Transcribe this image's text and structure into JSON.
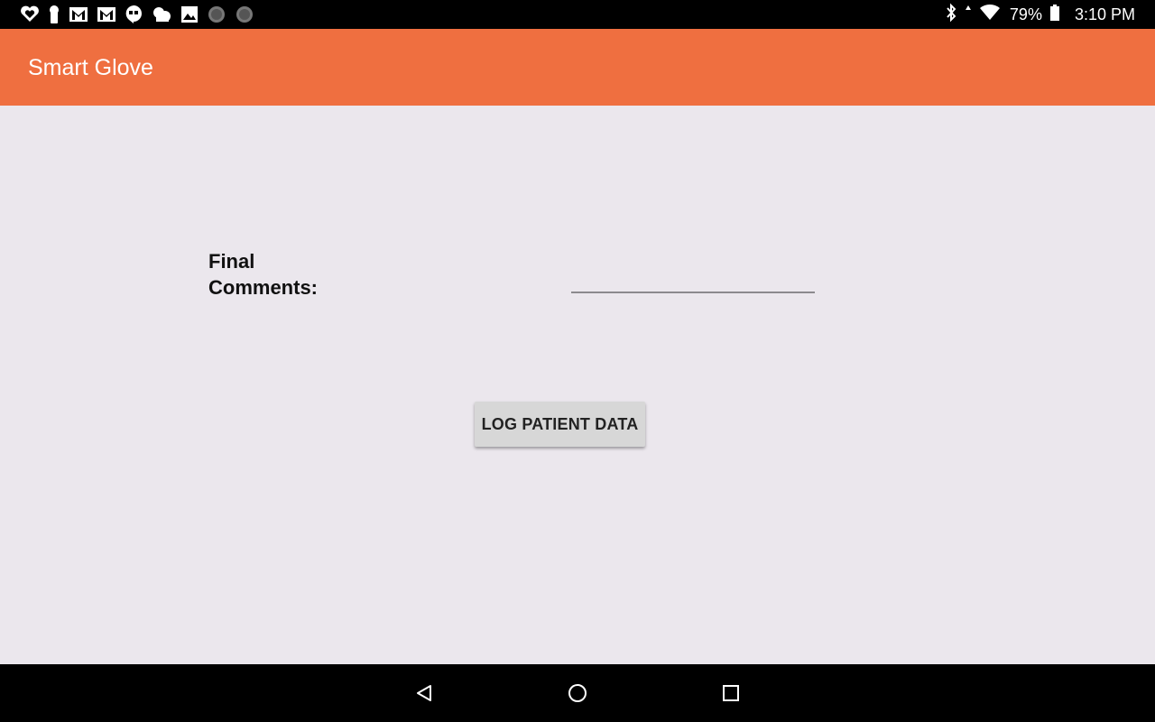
{
  "status_bar": {
    "notification_icons": [
      "heart-icon",
      "keyhole-icon",
      "gmail-icon",
      "gmail-icon",
      "hangouts-icon",
      "weather-icon",
      "photo-icon",
      "circle-icon",
      "circle-icon"
    ],
    "system_icons": [
      "bluetooth-icon",
      "wifi-icon",
      "battery-icon"
    ],
    "battery_percent": "79%",
    "time": "3:10 PM"
  },
  "app_bar": {
    "title": "Smart Glove",
    "color": "#ef6f40"
  },
  "form": {
    "final_comments_label": "Final Comments:",
    "final_comments_value": ""
  },
  "actions": {
    "log_button_label": "LOG PATIENT DATA"
  },
  "nav_bar": {
    "buttons": [
      "back-icon",
      "home-icon",
      "recents-icon"
    ]
  }
}
